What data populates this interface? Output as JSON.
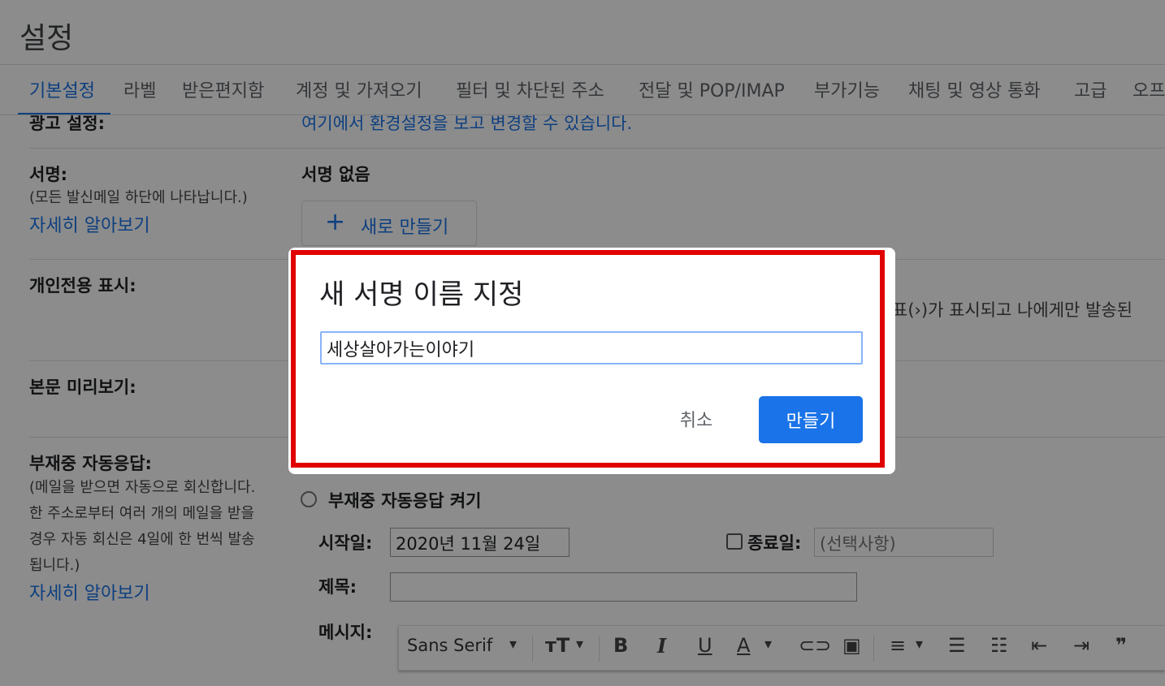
{
  "header": {
    "title": "설정"
  },
  "tabs": [
    {
      "label": "기본설정"
    },
    {
      "label": "라벨"
    },
    {
      "label": "받은편지함"
    },
    {
      "label": "계정 및 가져오기"
    },
    {
      "label": "필터 및 차단된 주소"
    },
    {
      "label": "전달 및 POP/IMAP"
    },
    {
      "label": "부가기능"
    },
    {
      "label": "채팅 및 영상 통화"
    },
    {
      "label": "고급"
    },
    {
      "label": "오프"
    }
  ],
  "ads": {
    "label": "광고 설정:",
    "text": "여기에서 환경설정을 보고 변경할 수 있습니다."
  },
  "signature": {
    "label": "서명:",
    "note": "(모든 발신메일 하단에 나타납니다.)",
    "link": "자세히 알아보기",
    "status": "서명 없음",
    "new_label": "새로 만들기"
  },
  "personal": {
    "label": "개인전용 표시:",
    "text_cut": "표(›)가 표시되고 나에게만 발송된"
  },
  "preview": {
    "label": "본문 미리보기:"
  },
  "vacation": {
    "label": "부재중 자동응답:",
    "note_lines": [
      "(메일을 받으면 자동으로 회신합니다.",
      "한 주소로부터 여러 개의 메일을 받을",
      "경우 자동 회신은 4일에 한 번씩 발송",
      "됩니다.)"
    ],
    "link": "자세히 알아보기",
    "on_label": "부재중 자동응답 켜기",
    "start_label": "시작일:",
    "start_value": "2020년 11월 24일",
    "end_label": "종료일:",
    "end_placeholder": "(선택사항)",
    "subject_label": "제목:",
    "message_label": "메시지:"
  },
  "toolbar": {
    "font": "Sans Serif"
  },
  "dialog": {
    "title": "새 서명 이름 지정",
    "input_value": "세상살아가는이야기",
    "cancel_label": "취소",
    "create_label": "만들기"
  },
  "colors": {
    "accent": "#1a73e8",
    "highlight": "#e00000"
  }
}
